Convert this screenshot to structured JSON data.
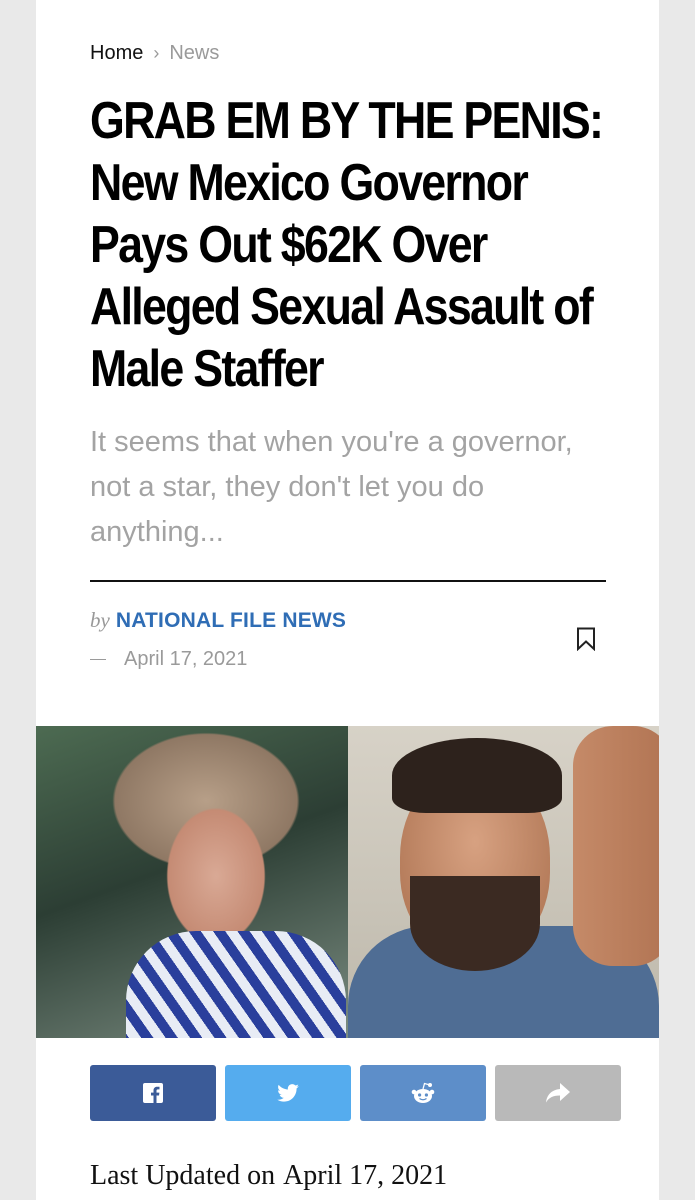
{
  "breadcrumb": {
    "home": "Home",
    "separator": "›",
    "current": "News"
  },
  "article": {
    "title": "GRAB EM BY THE PENIS: New Mexico Governor Pays Out $62K Over Alleged Sexual Assault of Male Staffer",
    "subtitle": "It seems that when you're a governor, not a star, they don't let you do anything...",
    "by_prefix": "by",
    "author": "NATIONAL FILE NEWS",
    "date": "April 17, 2021",
    "updated_label": "Last Updated on",
    "updated_date": "April 17, 2021"
  },
  "share": {
    "buttons": [
      {
        "name": "facebook",
        "icon": "facebook-icon",
        "color": "#3b5b98"
      },
      {
        "name": "twitter",
        "icon": "twitter-icon",
        "color": "#55acee"
      },
      {
        "name": "reddit",
        "icon": "reddit-icon",
        "color": "#5d8ec9"
      },
      {
        "name": "more",
        "icon": "share-arrow-icon",
        "color": "#b9b9b9"
      }
    ]
  },
  "colors": {
    "author": "#2f6db5",
    "subtitle": "#a3a3a3",
    "background": "#e9e9e9"
  }
}
